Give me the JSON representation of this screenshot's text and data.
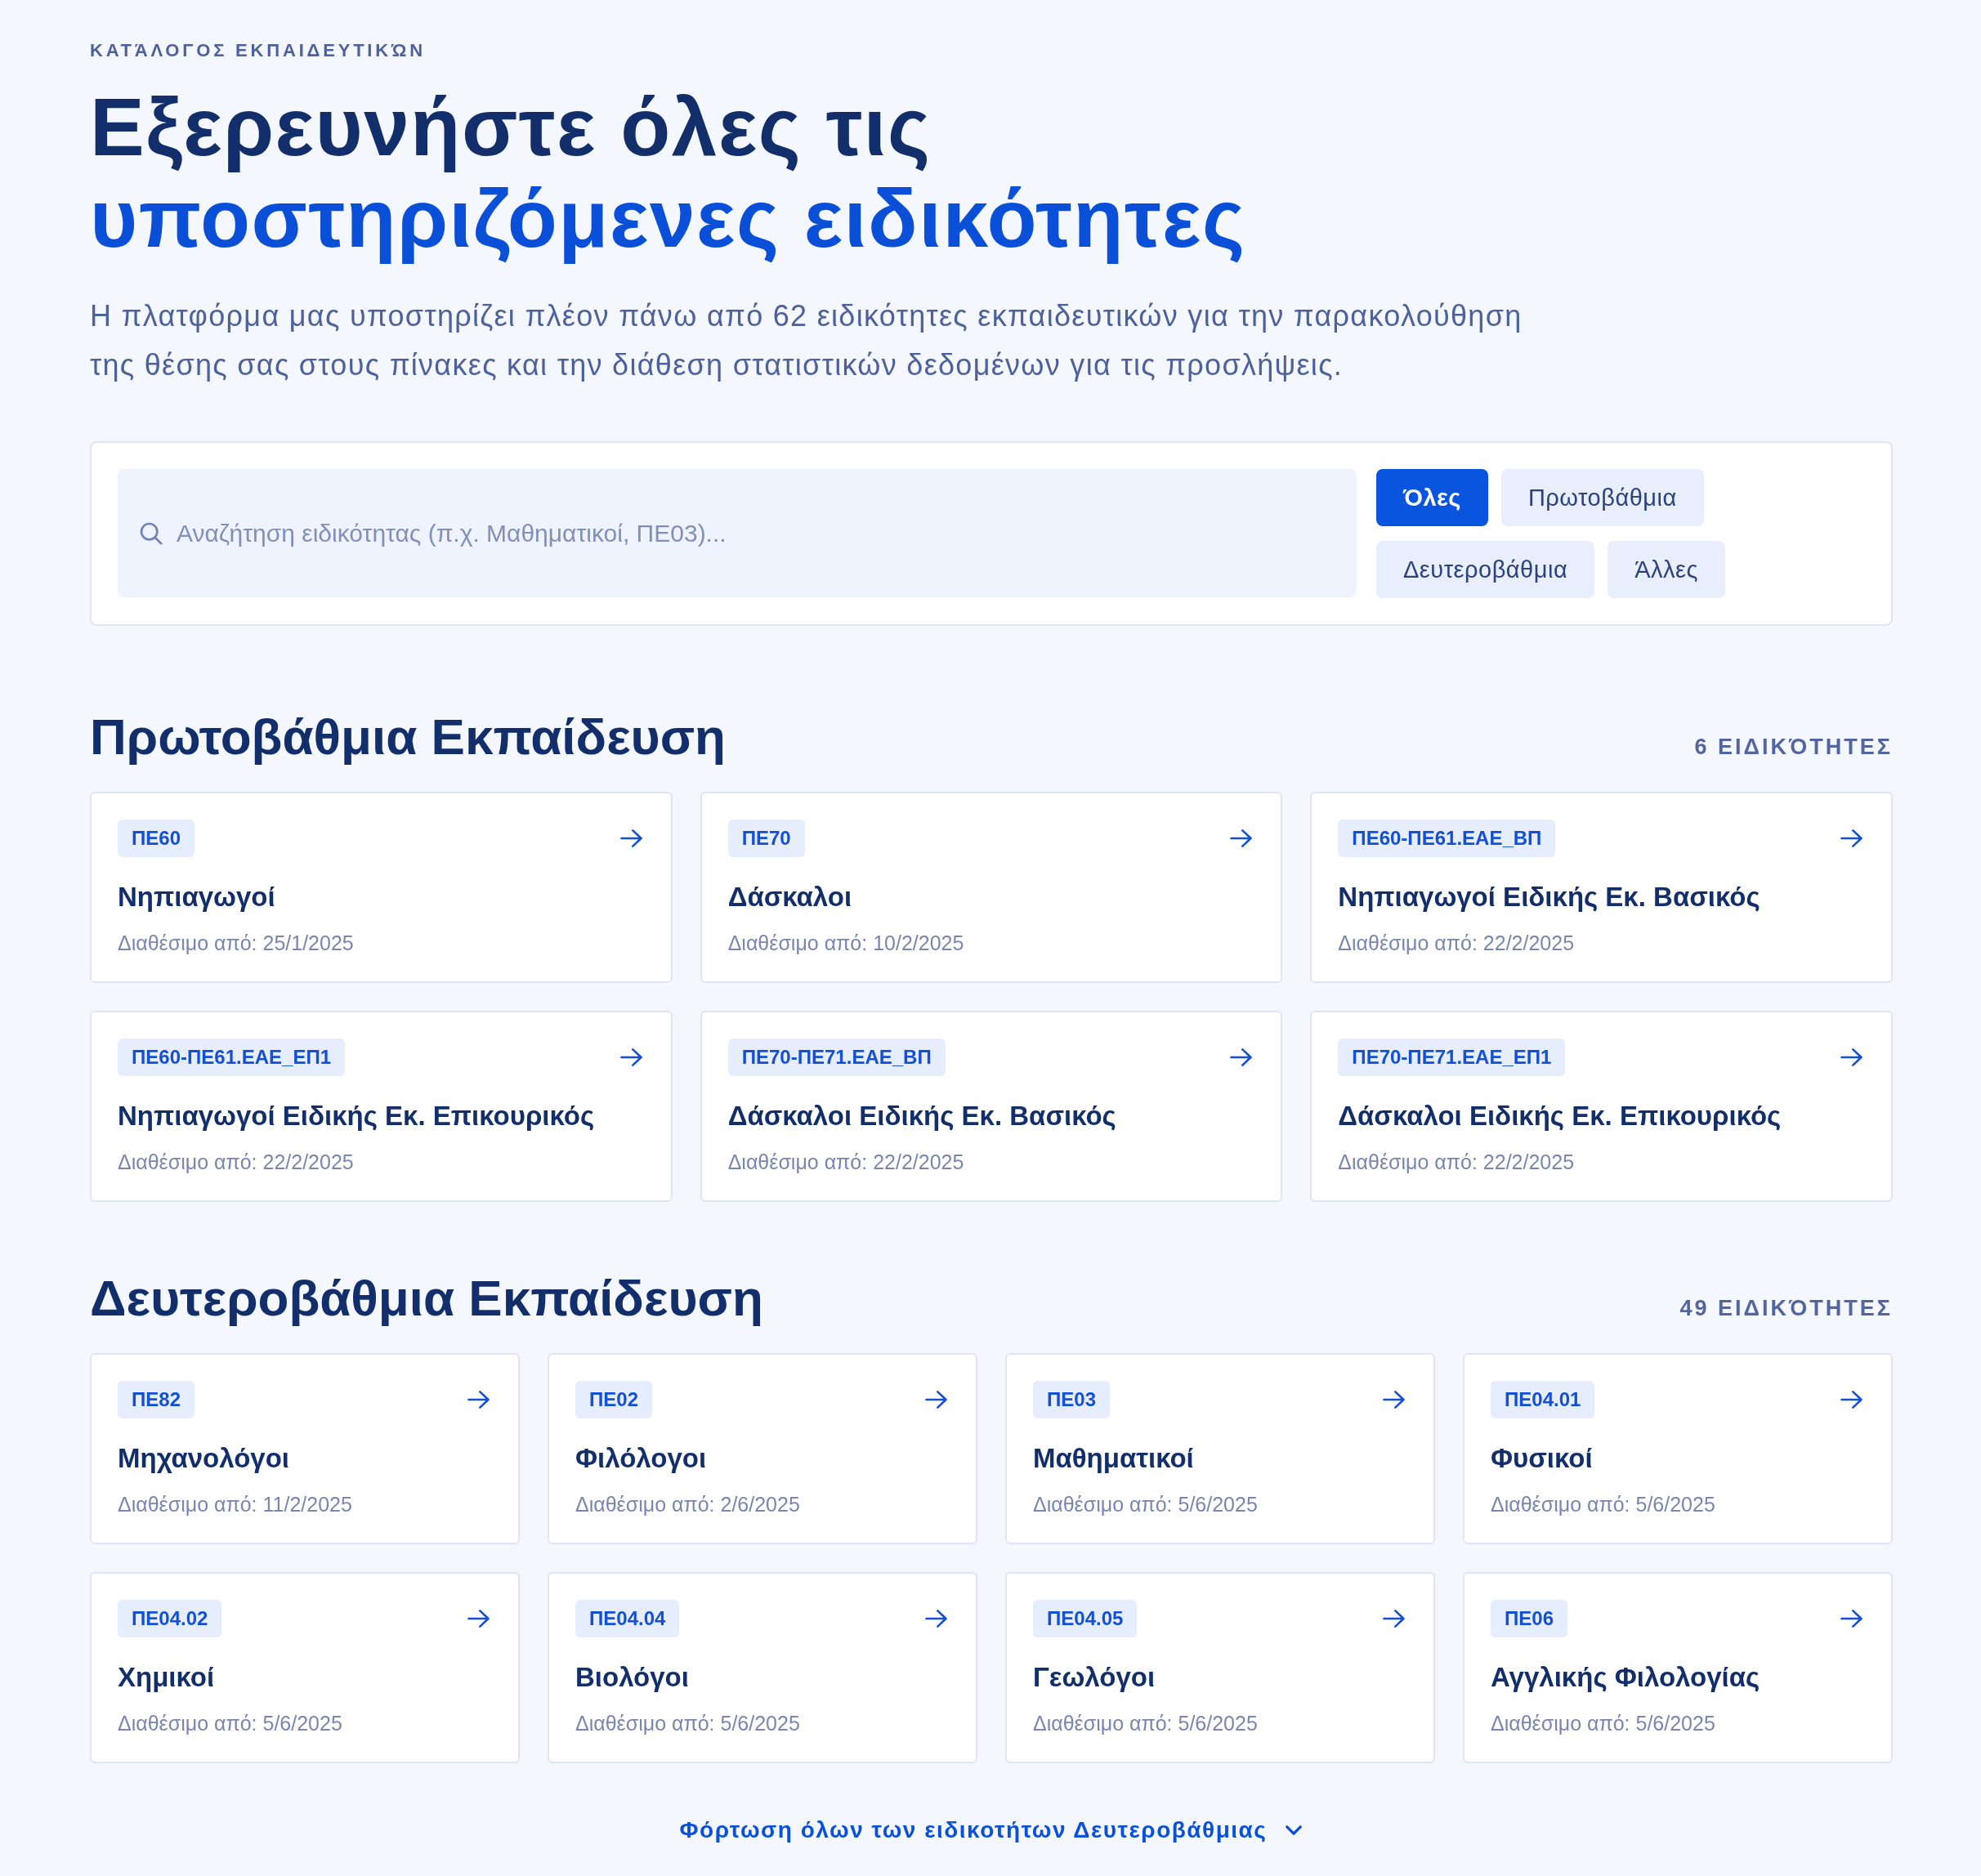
{
  "header": {
    "eyebrow": "ΚΑΤΆΛΟΓΟΣ ΕΚΠΑΙΔΕΥΤΙΚΏΝ",
    "title_line_1": "Εξερευνήστε όλες τις",
    "title_line_2": "υποστηριζόμενες ειδικότητες",
    "description": "Η πλατφόρμα μας υποστηρίζει πλέον πάνω από 62 ειδικότητες εκπαιδευτικών για την παρακολούθηση της θέσης σας στους πίνακες και την διάθεση στατιστικών δεδομένων για τις προσλήψεις."
  },
  "filter": {
    "search": {
      "placeholder": "Αναζήτηση ειδικότητας (π.χ. Μαθηματικοί, ΠΕ03)..."
    },
    "tabs": [
      {
        "label": "Όλες",
        "selected": true
      },
      {
        "label": "Πρωτοβάθμια",
        "selected": false
      },
      {
        "label": "Δευτεροβάθμια",
        "selected": false
      },
      {
        "label": "Άλλες",
        "selected": false
      }
    ]
  },
  "sections": [
    {
      "title": "Πρωτοβάθμια Εκπαίδευση",
      "count": "6 ΕΙΔΙΚΌΤΗΤΕΣ",
      "cards": [
        {
          "code": "ΠΕ60",
          "name": "Νηπιαγωγοί",
          "availability": "Διαθέσιμο από: 25/1/2025"
        },
        {
          "code": "ΠΕ70",
          "name": "Δάσκαλοι",
          "availability": "Διαθέσιμο από: 10/2/2025"
        },
        {
          "code": "ΠΕ60-ΠΕ61.ΕΑΕ_ΒΠ",
          "name": "Νηπιαγωγοί Ειδικής Εκ. Βασικός",
          "availability": "Διαθέσιμο από: 22/2/2025"
        },
        {
          "code": "ΠΕ60-ΠΕ61.ΕΑΕ_ΕΠ1",
          "name": "Νηπιαγωγοί Ειδικής Εκ. Επικουρικός",
          "availability": "Διαθέσιμο από: 22/2/2025"
        },
        {
          "code": "ΠΕ70-ΠΕ71.ΕΑΕ_ΒΠ",
          "name": "Δάσκαλοι Ειδικής Εκ. Βασικός",
          "availability": "Διαθέσιμο από: 22/2/2025"
        },
        {
          "code": "ΠΕ70-ΠΕ71.ΕΑΕ_ΕΠ1",
          "name": "Δάσκαλοι Ειδικής Εκ. Επικουρικός",
          "availability": "Διαθέσιμο από: 22/2/2025"
        }
      ]
    },
    {
      "title": "Δευτεροβάθμια Εκπαίδευση",
      "count": "49 ΕΙΔΙΚΌΤΗΤΕΣ",
      "cards": [
        {
          "code": "ΠΕ82",
          "name": "Μηχανολόγοι",
          "availability": "Διαθέσιμο από: 11/2/2025"
        },
        {
          "code": "ΠΕ02",
          "name": "Φιλόλογοι",
          "availability": "Διαθέσιμο από: 2/6/2025"
        },
        {
          "code": "ΠΕ03",
          "name": "Μαθηματικοί",
          "availability": "Διαθέσιμο από: 5/6/2025"
        },
        {
          "code": "ΠΕ04.01",
          "name": "Φυσικοί",
          "availability": "Διαθέσιμο από: 5/6/2025"
        },
        {
          "code": "ΠΕ04.02",
          "name": "Χημικοί",
          "availability": "Διαθέσιμο από: 5/6/2025"
        },
        {
          "code": "ΠΕ04.04",
          "name": "Βιολόγοι",
          "availability": "Διαθέσιμο από: 5/6/2025"
        },
        {
          "code": "ΠΕ04.05",
          "name": "Γεωλόγοι",
          "availability": "Διαθέσιμο από: 5/6/2025"
        },
        {
          "code": "ΠΕ06",
          "name": "Αγγλικής Φιλολογίας",
          "availability": "Διαθέσιμο από: 5/6/2025"
        }
      ]
    }
  ],
  "load_more": {
    "label": "Φόρτωση όλων των ειδικοτήτων Δευτεροβάθμιας"
  }
}
